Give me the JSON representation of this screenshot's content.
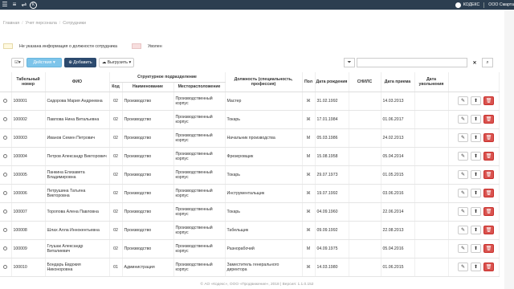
{
  "topbar": {
    "company": "КОДЕКС",
    "org": "ООО Смарта"
  },
  "breadcrumb": [
    "Главная",
    "Учет персонала",
    "Сотрудники"
  ],
  "legend": {
    "no_position": "Не указана информация о должности сотрудника",
    "dismissed": "Уволен"
  },
  "toolbar": {
    "actions": "Действия",
    "add": "Добавить",
    "export": "Выгрузить"
  },
  "search": {
    "placeholder": "",
    "value": ""
  },
  "columns": {
    "tab": "Табельный номер",
    "fio": "ФИО",
    "struct": "Структурное подразделение",
    "code": "Код",
    "name": "Наименование",
    "location": "Месторасположение",
    "position": "Должность (специальность, профессия)",
    "sex": "Пол",
    "birth": "Дата рождения",
    "snils": "СНИЛС",
    "hired": "Дата приема",
    "fired": "Дата увольнения"
  },
  "rows": [
    {
      "tab": "100001",
      "fio": "Сидорова Мария Андреевна",
      "code": "02",
      "name": "Производство",
      "loc": "Производственный корпус",
      "pos": "Мастер",
      "sex": "Ж",
      "birth": "31.02.1992",
      "snils": "",
      "hired": "14.03.2013",
      "fired": ""
    },
    {
      "tab": "100002",
      "fio": "Павлова Нина Витальевна",
      "code": "02",
      "name": "Производство",
      "loc": "Производственный корпус",
      "pos": "Токарь",
      "sex": "Ж",
      "birth": "17.01.1984",
      "snils": "",
      "hired": "01.06.2017",
      "fired": ""
    },
    {
      "tab": "100003",
      "fio": "Иванов Семен Петрович",
      "code": "02",
      "name": "Производство",
      "loc": "Производственный корпус",
      "pos": "Начальник производства",
      "sex": "М",
      "birth": "05.03.1986",
      "snils": "",
      "hired": "24.02.2013",
      "fired": ""
    },
    {
      "tab": "100004",
      "fio": "Петров Александр Викторович",
      "code": "02",
      "name": "Производство",
      "loc": "Производственный корпус",
      "pos": "Фрезеровщик",
      "sex": "М",
      "birth": "15.08.1958",
      "snils": "",
      "hired": "05.04.2014",
      "fired": ""
    },
    {
      "tab": "100005",
      "fio": "Панкина Елизавета Владимировна",
      "code": "02",
      "name": "Производство",
      "loc": "Производственный корпус",
      "pos": "Токарь",
      "sex": "Ж",
      "birth": "29.07.1973",
      "snils": "",
      "hired": "01.05.2015",
      "fired": ""
    },
    {
      "tab": "100006",
      "fio": "Петрушина Татьяна Викторовна",
      "code": "02",
      "name": "Производство",
      "loc": "Производственный корпус",
      "pos": "Инструментальщик",
      "sex": "Ж",
      "birth": "19.07.1992",
      "snils": "",
      "hired": "03.06.2016",
      "fired": ""
    },
    {
      "tab": "100007",
      "fio": "Торопова Алена Павловна",
      "code": "02",
      "name": "Производство",
      "loc": "Производственный корпус",
      "pos": "Токарь",
      "sex": "Ж",
      "birth": "04.09.1960",
      "snils": "",
      "hired": "22.06.2014",
      "fired": ""
    },
    {
      "tab": "100008",
      "fio": "Шлах Алла Иннокентьевна",
      "code": "02",
      "name": "Производство",
      "loc": "Производственный корпус",
      "pos": "Табельщик",
      "sex": "Ж",
      "birth": "09.09.1992",
      "snils": "",
      "hired": "22.08.2013",
      "fired": ""
    },
    {
      "tab": "100009",
      "fio": "Глушак Александр Виталиевич",
      "code": "02",
      "name": "Производство",
      "loc": "Производственный корпус",
      "pos": "Разнорабочий",
      "sex": "М",
      "birth": "04.09.1975",
      "snils": "",
      "hired": "05.04.2016",
      "fired": ""
    },
    {
      "tab": "100010",
      "fio": "Бондарь Евдокия Никоноровна",
      "code": "01",
      "name": "Администрация",
      "loc": "Производственный корпус",
      "pos": "Заместитель генерального директора",
      "sex": "Ж",
      "birth": "14.03.1980",
      "snils": "",
      "hired": "01.06.2015",
      "fired": ""
    }
  ],
  "footer": "© АО «Кодекс», ООО «Продвижение», 2018 | Версия: 1.1.0.152"
}
